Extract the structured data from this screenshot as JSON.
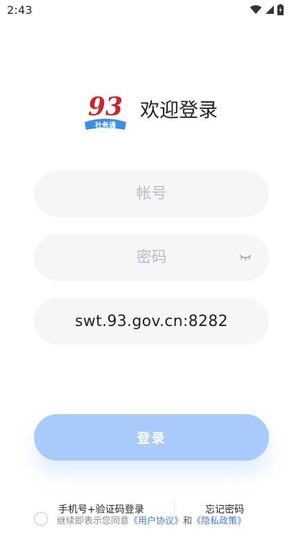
{
  "status_bar": {
    "time": "2:43",
    "icons": [
      "wifi-icon",
      "cellular-signal-icon",
      "battery-charging-icon"
    ]
  },
  "brand": {
    "logo_number": "93",
    "logo_label": "社务通",
    "welcome": "欢迎登录",
    "colors": {
      "logo_red": "#c8262b",
      "logo_blue": "#3d8ee8"
    }
  },
  "form": {
    "account_placeholder": "帐号",
    "password_placeholder": "密码",
    "server_value": "swt.93.gov.cn:8282",
    "password_toggle_icon": "eye-closed-icon"
  },
  "login_button": {
    "label": "登录",
    "color": "#a9cbfb"
  },
  "links": {
    "sms_login": "手机号+验证码登录",
    "forgot_password": "忘记密码"
  },
  "agreement": {
    "prefix": "继续即表示您同意",
    "user_agreement": "《用户协议》",
    "and": "和",
    "privacy_policy": "《隐私政策》",
    "link_color": "#3d7be6"
  }
}
